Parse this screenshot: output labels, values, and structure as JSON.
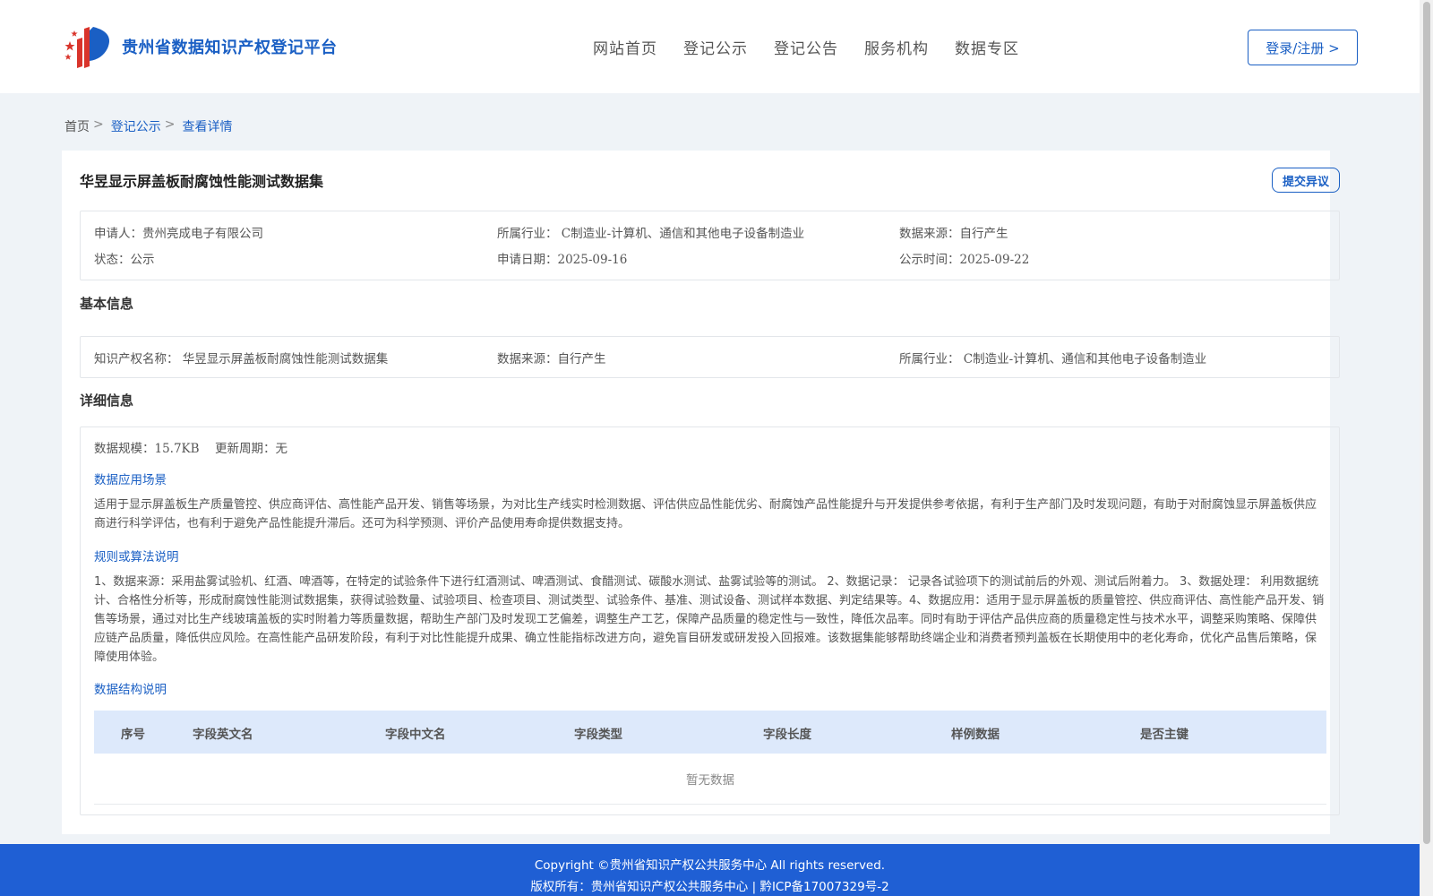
{
  "header": {
    "logo_text": "贵州省数据知识产权登记平台",
    "nav": [
      "网站首页",
      "登记公示",
      "登记公告",
      "服务机构",
      "数据专区"
    ],
    "login_label": "登录/注册 >"
  },
  "breadcrumb": {
    "home": "首页",
    "sep": ">",
    "level1": "登记公示",
    "current": "查看详情"
  },
  "detail": {
    "title": "华昱显示屏盖板耐腐蚀性能测试数据集",
    "objection_label": "提交异议",
    "summary": {
      "applicant_label": "申请人：",
      "applicant": "贵州亮成电子有限公司",
      "industry_label": "所属行业：",
      "industry": "C制造业-计算机、通信和其他电子设备制造业",
      "source_label": "数据来源：",
      "source": "自行产生",
      "status_label": "状态：",
      "status": "公示",
      "apply_date_label": "申请日期：",
      "apply_date": "2025-09-16",
      "publish_label": "公示时间：",
      "publish_date": "2025-09-22"
    },
    "basic": {
      "section_title": "基本信息",
      "ip_name_label": "知识产权名称：",
      "ip_name": "华昱显示屏盖板耐腐蚀性能测试数据集",
      "source_label": "数据来源：",
      "source": "自行产生",
      "industry_label": "所属行业：",
      "industry": "C制造业-计算机、通信和其他电子设备制造业"
    },
    "details": {
      "section_title": "详细信息",
      "scale_label": "数据规模：",
      "scale": "15.7KB",
      "cycle_label": "更新周期：",
      "cycle": "无",
      "scenario_title": "数据应用场景",
      "scenario_text": "适用于显示屏盖板生产质量管控、供应商评估、高性能产品开发、销售等场景，为对比生产线实时检测数据、评估供应品性能优劣、耐腐蚀产品性能提升与开发提供参考依据，有利于生产部门及时发现问题，有助于对耐腐蚀显示屏盖板供应商进行科学评估，也有利于避免产品性能提升滞后。还可为科学预测、评价产品使用寿命提供数据支持。",
      "rules_title": "规则或算法说明",
      "rules_text": "1、数据来源：采用盐雾试验机、红酒、啤酒等，在特定的试验条件下进行红酒测试、啤酒测试、食醋测试、碳酸水测试、盐雾试验等的测试。 2、数据记录： 记录各试验项下的测试前后的外观、测试后附着力。 3、数据处理： 利用数据统计、合格性分析等，形成耐腐蚀性能测试数据集，获得试验数量、试验项目、检查项目、测试类型、试验条件、基准、测试设备、测试样本数据、判定结果等。4、数据应用：适用于显示屏盖板的质量管控、供应商评估、高性能产品开发、销售等场景，通过对比生产线玻璃盖板的实时附着力等质量数据，帮助生产部门及时发现工艺偏差，调整生产工艺，保障产品质量的稳定性与一致性，降低次品率。同时有助于评估产品供应商的质量稳定性与技术水平，调整采购策略、保障供应链产品质量，降低供应风险。在高性能产品研发阶段，有利于对比性能提升成果、确立性能指标改进方向，避免盲目研发或研发投入回报难。该数据集能够帮助终端企业和消费者预判盖板在长期使用中的老化寿命，优化产品售后策略，保障使用体验。",
      "structure_title": "数据结构说明",
      "table_headers": [
        "序号",
        "字段英文名",
        "字段中文名",
        "字段类型",
        "字段长度",
        "样例数据",
        "是否主键"
      ],
      "empty_text": "暂无数据"
    }
  },
  "footer": {
    "copyright": "Copyright ©贵州省知识产权公共服务中心 All rights reserved.",
    "owner": "版权所有：贵州省知识产权公共服务中心 | 黔ICP备17007329号-2"
  }
}
